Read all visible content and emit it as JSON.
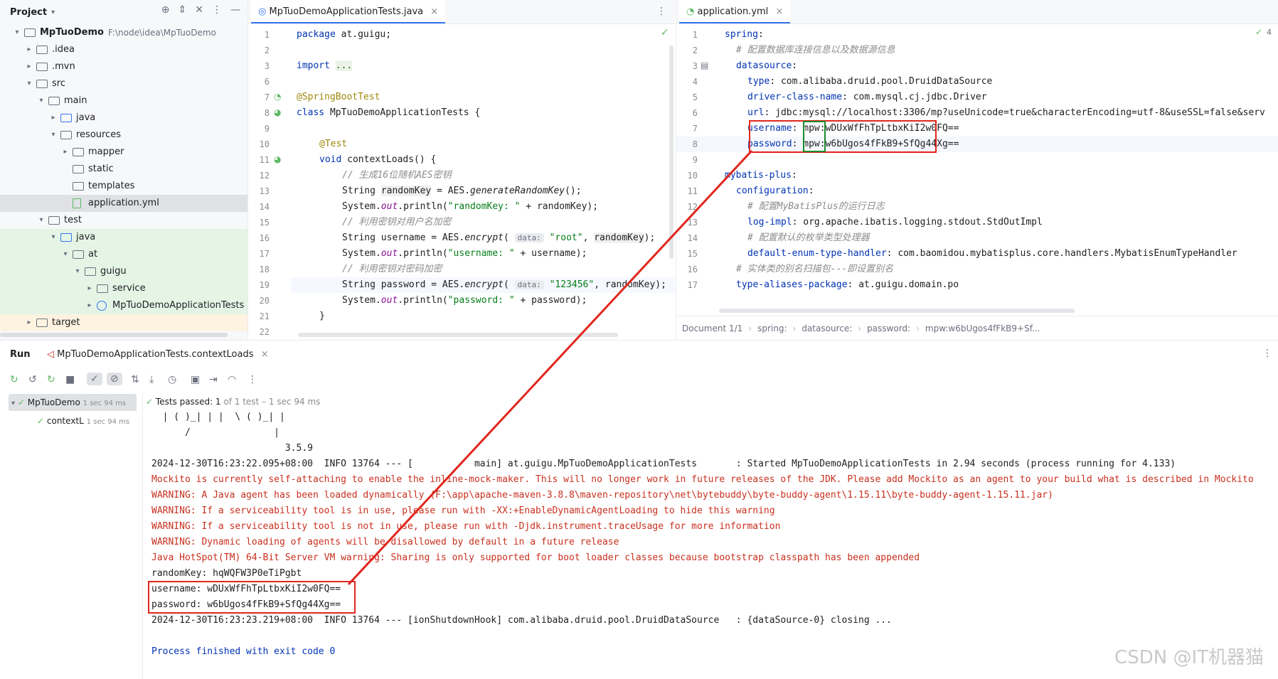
{
  "project": {
    "title": "Project",
    "root": "MpTuoDemo",
    "root_path": "F:\\node\\idea\\MpTuoDemo",
    "items": [
      {
        "label": ".idea"
      },
      {
        "label": ".mvn"
      },
      {
        "label": "src"
      },
      {
        "label": "main"
      },
      {
        "label": "java"
      },
      {
        "label": "resources"
      },
      {
        "label": "mapper"
      },
      {
        "label": "static"
      },
      {
        "label": "templates"
      },
      {
        "label": "application.yml"
      },
      {
        "label": "test"
      },
      {
        "label": "java"
      },
      {
        "label": "at"
      },
      {
        "label": "guigu"
      },
      {
        "label": "service"
      },
      {
        "label": "MpTuoDemoApplicationTests"
      },
      {
        "label": "target"
      }
    ]
  },
  "editor_left": {
    "tab": "MpTuoDemoApplicationTests.java",
    "line_numbers": [
      "1",
      "2",
      "3",
      "6",
      "7",
      "8",
      "9",
      "10",
      "11",
      "12",
      "13",
      "14",
      "15",
      "16",
      "17",
      "18",
      "19",
      "20",
      "21",
      "22"
    ],
    "lines": [
      "package at.guigu;",
      "",
      "import ...",
      "",
      "@SpringBootTest",
      "class MpTuoDemoApplicationTests {",
      "",
      "@Test",
      "void contextLoads() {",
      "// 生成16位随机AES密钥",
      "String randomKey = AES.generateRandomKey();",
      "System.out.println(\"randomKey: \" + randomKey);",
      "// 利用密钥对用户名加密",
      "String username = AES.encrypt(",
      "System.out.println(\"username: \" + username);",
      "// 利用密钥对密码加密",
      "String password = AES.encrypt(",
      "System.out.println(\"password: \" + password);",
      "}",
      ""
    ],
    "hint_data": "data:",
    "arg_root": "\"root\", randomKey);",
    "arg_pwd": "\"123456\", randomKey);"
  },
  "editor_right": {
    "tab": "application.yml",
    "problems": "4",
    "line_numbers": [
      "1",
      "2",
      "3",
      "4",
      "5",
      "6",
      "7",
      "8",
      "9",
      "10",
      "11",
      "12",
      "13",
      "14",
      "15",
      "16",
      "17"
    ],
    "lines": [
      "spring:",
      "# 配置数据库连接信息以及数据源信息",
      "datasource:",
      "type: com.alibaba.druid.pool.DruidDataSource",
      "driver-class-name: com.mysql.cj.jdbc.Driver",
      "url: jdbc:mysql://localhost:3306/mp?useUnicode=true&characterEncoding=utf-8&useSSL=false&serv",
      "username: mpw:wDUxWfFhTpLtbxKiI2w0FQ==",
      "password: mpw:w6bUgos4fFkB9+SfQg44Xg==",
      "",
      "mybatis-plus:",
      "configuration:",
      "# 配置MyBatisPlus的运行日志",
      "log-impl: org.apache.ibatis.logging.stdout.StdOutImpl",
      "# 配置默认的枚举类型处理器",
      "default-enum-type-handler: com.baomidou.mybatisplus.core.handlers.MybatisEnumTypeHandler",
      "# 实体类的别名扫描包---即设置别名",
      "type-aliases-package: at.guigu.domain.po"
    ],
    "breadcrumb": [
      "Document 1/1",
      "spring:",
      "datasource:",
      "password:",
      "mpw:w6bUgos4fFkB9+Sf..."
    ]
  },
  "run": {
    "tab_run": "Run",
    "config_tab": "MpTuoDemoApplicationTests.contextLoads",
    "status": "Tests passed: 1",
    "status_detail": "of 1 test – 1 sec 94 ms",
    "tree": [
      {
        "label": "MpTuoDemo",
        "time": "1 sec 94 ms"
      },
      {
        "label": "contextL",
        "time": "1 sec 94 ms"
      }
    ],
    "console": [
      {
        "text": "  | ( )_| | |  \\ ( )_| |",
        "cls": "blk"
      },
      {
        "text": "      /               |",
        "cls": "blk"
      },
      {
        "text": "                        3.5.9",
        "cls": "blk"
      },
      {
        "text": "2024-12-30T16:23:22.095+08:00  INFO 13764 --- [           main] at.guigu.MpTuoDemoApplicationTests       : Started MpTuoDemoApplicationTests in 2.94 seconds (process running for 4.133)",
        "cls": "blk"
      },
      {
        "text": "Mockito is currently self-attaching to enable the inline-mock-maker. This will no longer work in future releases of the JDK. Please add Mockito as an agent to your build what is described in Mockito",
        "cls": "red"
      },
      {
        "text": "WARNING: A Java agent has been loaded dynamically (F:\\app\\apache-maven-3.8.8\\maven-repository\\net\\bytebuddy\\byte-buddy-agent\\1.15.11\\byte-buddy-agent-1.15.11.jar)",
        "cls": "red"
      },
      {
        "text": "WARNING: If a serviceability tool is in use, please run with -XX:+EnableDynamicAgentLoading to hide this warning",
        "cls": "red"
      },
      {
        "text": "WARNING: If a serviceability tool is not in use, please run with -Djdk.instrument.traceUsage for more information",
        "cls": "red"
      },
      {
        "text": "WARNING: Dynamic loading of agents will be disallowed by default in a future release",
        "cls": "red"
      },
      {
        "text": "Java HotSpot(TM) 64-Bit Server VM warning: Sharing is only supported for boot loader classes because bootstrap classpath has been appended",
        "cls": "red"
      },
      {
        "text": "randomKey: hqWQFW3P0eTiPgbt",
        "cls": "blk"
      },
      {
        "text": "username: wDUxWfFhTpLtbxKiI2w0FQ==",
        "cls": "blk"
      },
      {
        "text": "password: w6bUgos4fFkB9+SfQg44Xg==",
        "cls": "blk"
      },
      {
        "text": "2024-12-30T16:23:23.219+08:00  INFO 13764 --- [ionShutdownHook] com.alibaba.druid.pool.DruidDataSource   : {dataSource-0} closing ...",
        "cls": "blk"
      },
      {
        "text": "",
        "cls": "blk"
      },
      {
        "text": "Process finished with exit code 0",
        "cls": "blu"
      }
    ]
  },
  "watermark": "CSDN @IT机器猫"
}
